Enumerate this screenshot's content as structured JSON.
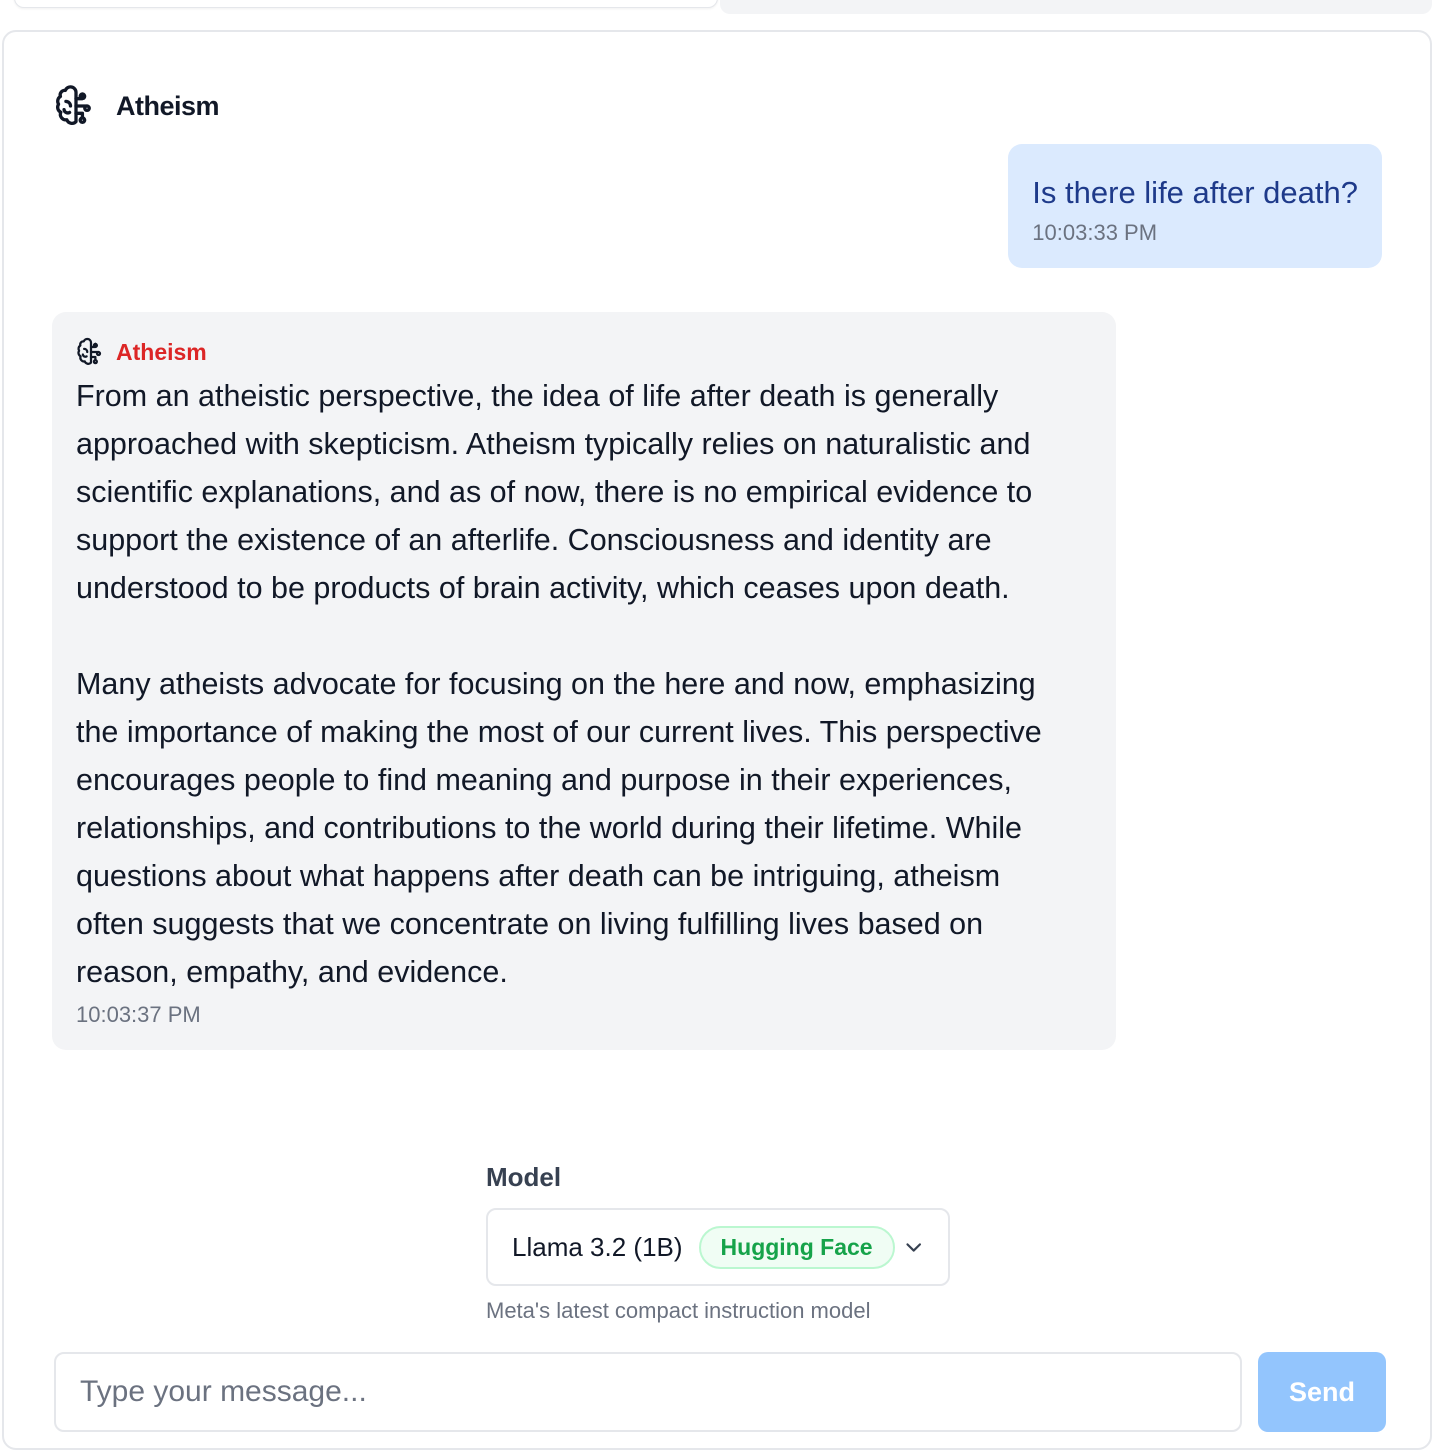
{
  "header": {
    "title": "Atheism",
    "icon": "brain-icon"
  },
  "messages": [
    {
      "role": "user",
      "text": "Is there life after death?",
      "time": "10:03:33 PM"
    },
    {
      "role": "assistant",
      "author": "Atheism",
      "icon": "brain-icon",
      "text": "From an atheistic perspective, the idea of life after death is generally\napproached with skepticism. Atheism typically relies on naturalistic and\nscientific explanations, and as of now, there is no empirical evidence to\nsupport the existence of an afterlife. Consciousness and identity are\nunderstood to be products of brain activity, which ceases upon death.\n\nMany atheists advocate for focusing on the here and now, emphasizing\nthe importance of making the most of our current lives. This perspective\nencourages people to find meaning and purpose in their experiences,\nrelationships, and contributions to the world during their lifetime. While\nquestions about what happens after death can be intriguing, atheism\noften suggests that we concentrate on living fulfilling lives based on\nreason, empathy, and evidence.",
      "time": "10:03:37 PM"
    }
  ],
  "model": {
    "label": "Model",
    "selected": "Llama 3.2 (1B)",
    "provider_badge": "Hugging Face",
    "description": "Meta's latest compact instruction model"
  },
  "composer": {
    "placeholder": "Type your message...",
    "send_label": "Send"
  },
  "colors": {
    "user_bubble": "#dbeafe",
    "user_text": "#1e3a8a",
    "bot_bubble": "#f3f4f6",
    "bot_name": "#dc2626",
    "badge_text": "#16a34a",
    "send_button": "#93c5fd"
  }
}
